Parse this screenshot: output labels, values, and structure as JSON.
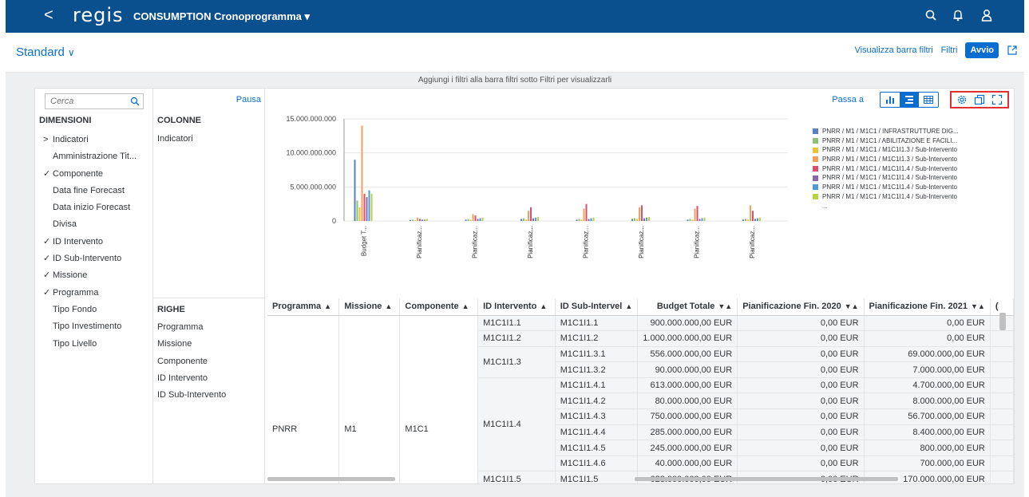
{
  "shell": {
    "back": "<",
    "logo": "regis",
    "title": "CONSUMPTION Cronoprogramma ▾"
  },
  "header": {
    "variant": "Standard",
    "links": {
      "show_filter_bar": "Visualizza barra filtri",
      "filters": "Filtri",
      "go": "Avvio"
    }
  },
  "infobar": "Aggiungi i filtri alla barra filtri sotto Filtri per visualizzarli",
  "dimensions": {
    "search_placeholder": "Cerca",
    "title": "DIMENSIONI",
    "items": [
      {
        "mark": ">",
        "label": "Indicatori"
      },
      {
        "mark": "",
        "label": "Amministrazione Tit..."
      },
      {
        "mark": "✓",
        "label": "Componente"
      },
      {
        "mark": "",
        "label": "Data fine Forecast"
      },
      {
        "mark": "",
        "label": "Data inizio Forecast"
      },
      {
        "mark": "",
        "label": "Divisa"
      },
      {
        "mark": "✓",
        "label": "ID Intervento"
      },
      {
        "mark": "✓",
        "label": "ID Sub-Intervento"
      },
      {
        "mark": "✓",
        "label": "Missione"
      },
      {
        "mark": "✓",
        "label": "Programma"
      },
      {
        "mark": "",
        "label": "Tipo Fondo"
      },
      {
        "mark": "",
        "label": "Tipo Investimento"
      },
      {
        "mark": "",
        "label": "Tipo Livello"
      }
    ]
  },
  "columns_section": {
    "pause": "Pausa",
    "title": "COLONNE",
    "items": [
      "Indicatori"
    ]
  },
  "rows_section": {
    "title": "RIGHE",
    "items": [
      "Programma",
      "Missione",
      "Componente",
      "ID Intervento",
      "ID Sub-Intervento"
    ]
  },
  "toolbar": {
    "jump_to": "Passa a"
  },
  "chart_data": {
    "type": "bar",
    "title": "",
    "ylim": [
      0,
      15000000000
    ],
    "yticks": [
      "15.000.000.000",
      "10.000.000.000",
      "5.000.000.000",
      "0"
    ],
    "categories": [
      "Budget T...",
      "Pianificaz...",
      "Pianificaz...",
      "Pianificaz...",
      "Pianificaz...",
      "Pianificaz...",
      "Pianificaz...",
      "Pianificaz..."
    ],
    "series": [
      {
        "name": "PNRR / M1 / M1C1 / INFRASTRUTTURE DIG...",
        "color": "#5b7fbf",
        "values": [
          9000000000,
          100000000,
          200000000,
          300000000,
          200000000,
          300000000,
          200000000,
          200000000
        ]
      },
      {
        "name": "PNRR / M1 / M1C1 / ABILITAZIONE E FACILI...",
        "color": "#8dc26e",
        "values": [
          3000000000,
          200000000,
          300000000,
          400000000,
          300000000,
          400000000,
          300000000,
          300000000
        ]
      },
      {
        "name": "PNRR / M1 / M1C1 / M1C1I1.3 / Sub-Intervento",
        "color": "#e8c33a",
        "values": [
          2000000000,
          100000000,
          200000000,
          200000000,
          200000000,
          300000000,
          200000000,
          200000000
        ]
      },
      {
        "name": "PNRR / M1 / M1C1 / M1C1I1.3 / Sub-Intervento",
        "color": "#f2a05c",
        "values": [
          14000000000,
          500000000,
          1000000000,
          1500000000,
          1800000000,
          2000000000,
          1800000000,
          2300000000
        ]
      },
      {
        "name": "PNRR / M1 / M1C1 / M1C1I1.4 / Sub-Intervento",
        "color": "#d9506b",
        "values": [
          4000000000,
          300000000,
          800000000,
          2000000000,
          2500000000,
          2300000000,
          2200000000,
          1500000000
        ]
      },
      {
        "name": "PNRR / M1 / M1C1 / M1C1I1.4 / Sub-Intervento",
        "color": "#8a68b0",
        "values": [
          3500000000,
          200000000,
          300000000,
          400000000,
          300000000,
          400000000,
          300000000,
          300000000
        ]
      },
      {
        "name": "PNRR / M1 / M1C1 / M1C1I1.4 / Sub-Intervento",
        "color": "#4a9bd4",
        "values": [
          4500000000,
          200000000,
          400000000,
          500000000,
          400000000,
          500000000,
          400000000,
          400000000
        ]
      },
      {
        "name": "PNRR / M1 / M1C1 / M1C1I1.4 / Sub-Intervento",
        "color": "#b7d342",
        "values": [
          4000000000,
          300000000,
          500000000,
          600000000,
          500000000,
          600000000,
          500000000,
          500000000
        ]
      }
    ],
    "legend_more": "..."
  },
  "table": {
    "headers": [
      "Programma",
      "Missione",
      "Componente",
      "ID Intervento",
      "ID Sub-Intervel",
      "Budget Totale",
      "Pianificazione Fin. 2020",
      "Pianificazione Fin. 2021"
    ],
    "programma": "PNRR",
    "missione": "M1",
    "componente": "M1C1",
    "interventions": [
      {
        "id": "M1C1I1.1",
        "subs": [
          {
            "sub": "M1C1I1.1",
            "budget": "900.000.000,00 EUR",
            "p2020": "0,00 EUR",
            "p2021": "0,00 EUR"
          }
        ]
      },
      {
        "id": "M1C1I1.2",
        "subs": [
          {
            "sub": "M1C1I1.2",
            "budget": "1.000.000.000,00 EUR",
            "p2020": "0,00 EUR",
            "p2021": "0,00 EUR"
          }
        ]
      },
      {
        "id": "M1C1I1.3",
        "subs": [
          {
            "sub": "M1C1I1.3.1",
            "budget": "556.000.000,00 EUR",
            "p2020": "0,00 EUR",
            "p2021": "69.000.000,00 EUR"
          },
          {
            "sub": "M1C1I1.3.2",
            "budget": "90.000.000,00 EUR",
            "p2020": "0,00 EUR",
            "p2021": "7.000.000,00 EUR"
          }
        ]
      },
      {
        "id": "M1C1I1.4",
        "subs": [
          {
            "sub": "M1C1I1.4.1",
            "budget": "613.000.000,00 EUR",
            "p2020": "0,00 EUR",
            "p2021": "4.700.000,00 EUR"
          },
          {
            "sub": "M1C1I1.4.2",
            "budget": "80.000.000,00 EUR",
            "p2020": "0,00 EUR",
            "p2021": "8.000.000,00 EUR"
          },
          {
            "sub": "M1C1I1.4.3",
            "budget": "750.000.000,00 EUR",
            "p2020": "0,00 EUR",
            "p2021": "56.700.000,00 EUR"
          },
          {
            "sub": "M1C1I1.4.4",
            "budget": "285.000.000,00 EUR",
            "p2020": "0,00 EUR",
            "p2021": "8.400.000,00 EUR"
          },
          {
            "sub": "M1C1I1.4.5",
            "budget": "245.000.000,00 EUR",
            "p2020": "0,00 EUR",
            "p2021": "800.000,00 EUR"
          },
          {
            "sub": "M1C1I1.4.6",
            "budget": "40.000.000,00 EUR",
            "p2020": "0,00 EUR",
            "p2021": "700.000,00 EUR"
          }
        ]
      },
      {
        "id": "M1C1I1.5",
        "subs": [
          {
            "sub": "M1C1I1.5",
            "budget": "623.000.000,00 EUR",
            "p2020": "0,00 EUR",
            "p2021": "170.000.000,00 EUR"
          }
        ]
      }
    ]
  }
}
